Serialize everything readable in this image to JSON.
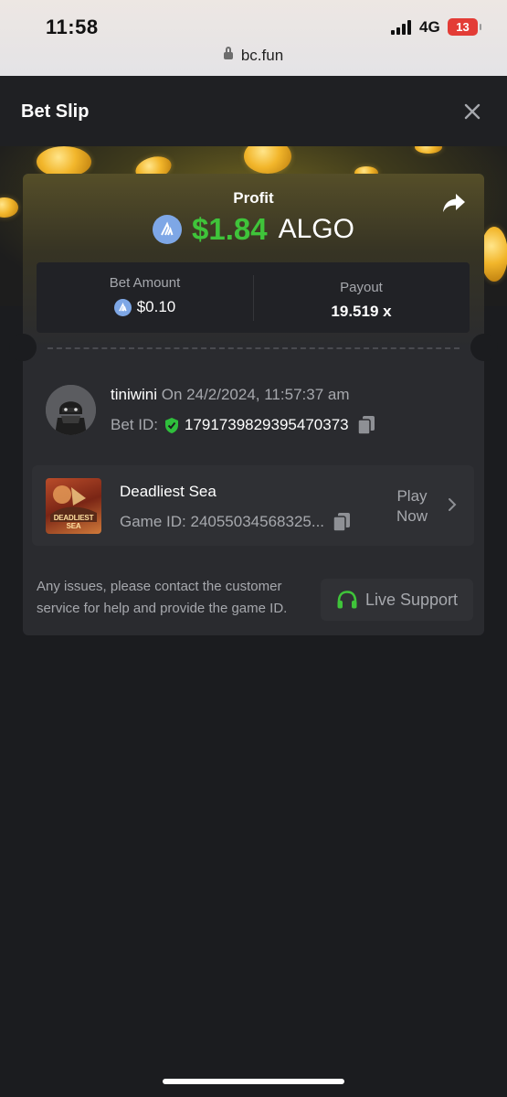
{
  "status_bar": {
    "time": "11:58",
    "network": "4G",
    "battery": "13",
    "url": "bc.fun"
  },
  "header": {
    "title": "Bet Slip",
    "close_icon": "close-icon"
  },
  "profit": {
    "label": "Profit",
    "amount": "$1.84",
    "currency": "ALGO",
    "currency_icon": "algo-coin-icon",
    "share_icon": "share-icon",
    "color": "#3fc43a"
  },
  "stats": {
    "bet_amount_label": "Bet Amount",
    "bet_amount_value": "$0.10",
    "payout_label": "Payout",
    "payout_value": "19.519 x"
  },
  "bet": {
    "username": "tiniwini",
    "timestamp": "On 24/2/2024, 11:57:37 am",
    "bet_id_label": "Bet ID:",
    "bet_id": "1791739829395470373",
    "verified_icon": "shield-check-icon",
    "copy_icon": "copy-icon"
  },
  "game": {
    "name": "Deadliest Sea",
    "thumb_text": "DEADLIEST SEA",
    "game_id_label": "Game ID:",
    "game_id": "24055034568325...",
    "play_label_1": "Play",
    "play_label_2": "Now"
  },
  "support": {
    "help_text": "Any issues, please contact the customer service for help and provide the game ID.",
    "live_support_label": "Live Support",
    "headset_icon": "headset-icon",
    "accent": "#3fc43a"
  }
}
